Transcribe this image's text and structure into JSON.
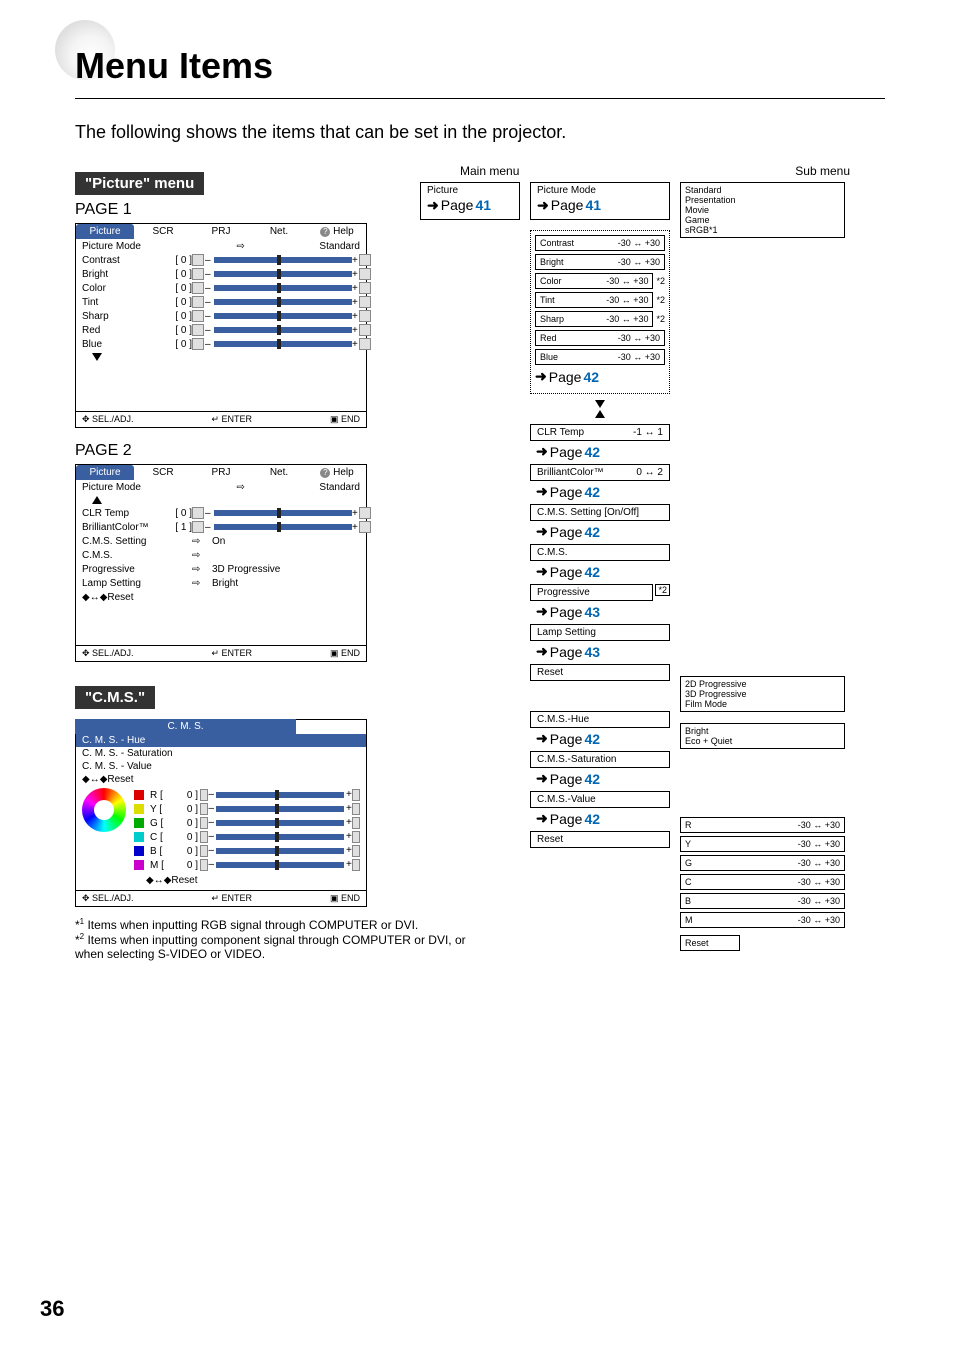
{
  "title": "Menu Items",
  "intro": "The following shows the items that can be set in the projector.",
  "pageNumber": "36",
  "pictureTag": "\"Picture\" menu",
  "cmsTag": "\"C.M.S.\"",
  "labels": {
    "page1": "PAGE 1",
    "page2": "PAGE 2",
    "mainMenu": "Main menu",
    "subMenu": "Sub menu"
  },
  "tabs": [
    "Picture",
    "SCR",
    "PRJ",
    "Net.",
    "Help"
  ],
  "menu1": {
    "pictureModeLabel": "Picture Mode",
    "pictureModeValue": "Standard",
    "rows": [
      {
        "label": "Contrast",
        "val": "0"
      },
      {
        "label": "Bright",
        "val": "0"
      },
      {
        "label": "Color",
        "val": "0"
      },
      {
        "label": "Tint",
        "val": "0"
      },
      {
        "label": "Sharp",
        "val": "0"
      },
      {
        "label": "Red",
        "val": "0"
      },
      {
        "label": "Blue",
        "val": "0"
      }
    ]
  },
  "menu2": {
    "pictureModeLabel": "Picture Mode",
    "pictureModeValue": "Standard",
    "rows": [
      {
        "label": "CLR Temp",
        "val": "0"
      },
      {
        "label": "BrilliantColor™",
        "val": "1"
      }
    ],
    "extras": [
      {
        "label": "C.M.S. Setting",
        "val": "On"
      },
      {
        "label": "C.M.S.",
        "val": ""
      },
      {
        "label": "Progressive",
        "val": "3D Progressive"
      },
      {
        "label": "Lamp Setting",
        "val": "Bright"
      }
    ],
    "reset": "Reset"
  },
  "cms": {
    "title": "C. M. S.",
    "hue": "C. M. S. - Hue",
    "sat": "C. M. S. - Saturation",
    "valLabel": "C. M. S. - Value",
    "reset": "Reset",
    "channels": [
      {
        "ch": "R",
        "color": "#d00",
        "val": "0"
      },
      {
        "ch": "Y",
        "color": "#dd0",
        "val": "0"
      },
      {
        "ch": "G",
        "color": "#0a0",
        "val": "0"
      },
      {
        "ch": "C",
        "color": "#0cc",
        "val": "0"
      },
      {
        "ch": "B",
        "color": "#00c",
        "val": "0"
      },
      {
        "ch": "M",
        "color": "#c0c",
        "val": "0"
      }
    ],
    "reset2": "Reset"
  },
  "footerBar": {
    "sel": "SEL./ADJ.",
    "enter": "ENTER",
    "end": "END"
  },
  "footnotes": {
    "f1": "Items when inputting RGB signal through COMPUTER or DVI.",
    "f2": "Items when inputting component signal through COMPUTER or DVI, or when selecting S-VIDEO or VIDEO."
  },
  "tree": {
    "picture": {
      "title": "Picture",
      "page": "41"
    },
    "pictureMode": {
      "title": "Picture Mode",
      "page": "41",
      "options": [
        "Standard",
        "Presentation",
        "Movie",
        "Game",
        "sRGB*1"
      ]
    },
    "adjust": [
      {
        "label": "Contrast",
        "range": "-30 ↔ +30",
        "note": ""
      },
      {
        "label": "Bright",
        "range": "-30 ↔ +30",
        "note": ""
      },
      {
        "label": "Color",
        "range": "-30 ↔ +30",
        "note": "*2"
      },
      {
        "label": "Tint",
        "range": "-30 ↔ +30",
        "note": "*2"
      },
      {
        "label": "Sharp",
        "range": "-30 ↔ +30",
        "note": "*2"
      },
      {
        "label": "Red",
        "range": "-30 ↔ +30",
        "note": ""
      },
      {
        "label": "Blue",
        "range": "-30 ↔ +30",
        "note": ""
      }
    ],
    "adjustPage": "42",
    "clrTemp": {
      "label": "CLR Temp",
      "range": "-1 ↔ 1",
      "page": "42"
    },
    "brilliant": {
      "label": "BrilliantColor™",
      "range": "0 ↔ 2",
      "page": "42"
    },
    "cmsSetting": {
      "label": "C.M.S. Setting [On/Off]",
      "page": "42"
    },
    "cmsItem": {
      "label": "C.M.S.",
      "page": "42"
    },
    "progressive": {
      "label": "Progressive",
      "note": "*2",
      "page": "43",
      "options": [
        "2D Progressive",
        "3D Progressive",
        "Film Mode"
      ]
    },
    "lamp": {
      "label": "Lamp Setting",
      "page": "43",
      "options": [
        "Bright",
        "Eco + Quiet"
      ]
    },
    "reset": "Reset",
    "cmsSub": {
      "hue": {
        "label": "C.M.S.-Hue",
        "page": "42"
      },
      "sat": {
        "label": "C.M.S.-Saturation",
        "page": "42"
      },
      "val": {
        "label": "C.M.S.-Value",
        "page": "42"
      },
      "reset": "Reset",
      "rgb": [
        {
          "ch": "R",
          "range": "-30 ↔ +30"
        },
        {
          "ch": "Y",
          "range": "-30 ↔ +30"
        },
        {
          "ch": "G",
          "range": "-30 ↔ +30"
        },
        {
          "ch": "C",
          "range": "-30 ↔ +30"
        },
        {
          "ch": "B",
          "range": "-30 ↔ +30"
        },
        {
          "ch": "M",
          "range": "-30 ↔ +30"
        }
      ],
      "resetSub": "Reset"
    }
  }
}
